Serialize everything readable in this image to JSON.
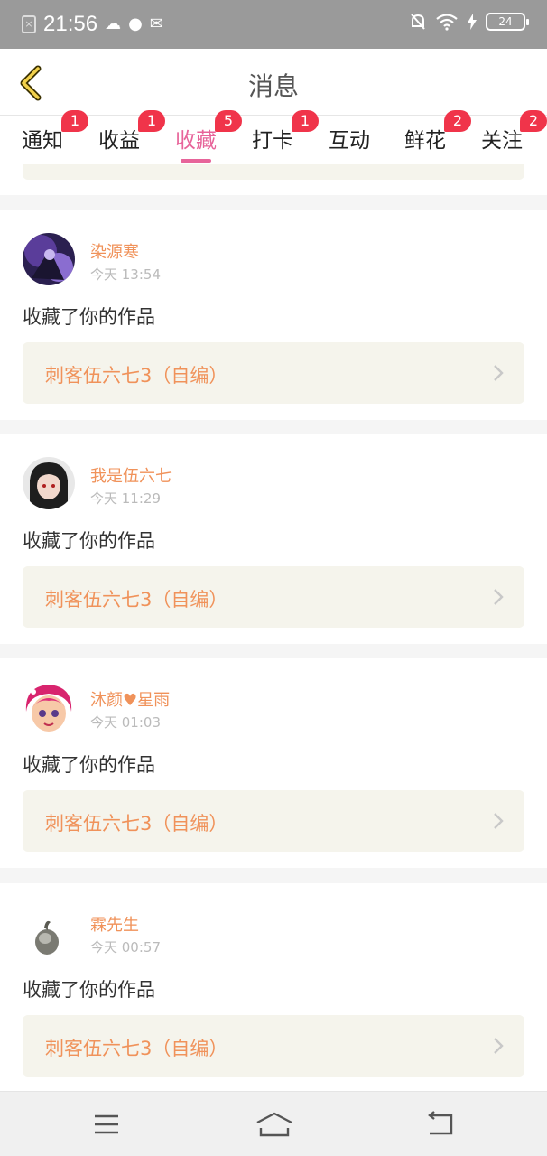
{
  "status_bar": {
    "time": "21:56",
    "battery": "24",
    "icons": [
      "sim-off-icon",
      "cloud-icon",
      "planet-icon",
      "mail-icon",
      "bell-off-icon",
      "wifi-icon",
      "charging-icon",
      "battery-icon"
    ]
  },
  "header": {
    "title": "消息",
    "back_icon": "chevron-left-icon"
  },
  "tabs": [
    {
      "label": "通知",
      "badge": "1",
      "active": false
    },
    {
      "label": "收益",
      "badge": "1",
      "active": false
    },
    {
      "label": "收藏",
      "badge": "5",
      "active": true
    },
    {
      "label": "打卡",
      "badge": "1",
      "active": false
    },
    {
      "label": "互动",
      "badge": "",
      "active": false
    },
    {
      "label": "鲜花",
      "badge": "2",
      "active": false
    },
    {
      "label": "关注",
      "badge": "2",
      "active": false
    }
  ],
  "messages": [
    {
      "user": "染源寒",
      "time": "今天 13:54",
      "action": "收藏了你的作品",
      "work": "刺客伍六七3（自编）"
    },
    {
      "user": "我是伍六七",
      "time": "今天 11:29",
      "action": "收藏了你的作品",
      "work": "刺客伍六七3（自编）"
    },
    {
      "user": "沐颜♥星雨",
      "time": "今天 01:03",
      "action": "收藏了你的作品",
      "work": "刺客伍六七3（自编）"
    },
    {
      "user": "霖先生",
      "time": "今天 00:57",
      "action": "收藏了你的作品",
      "work": "刺客伍六七3（自编）"
    }
  ],
  "nav_bar": {
    "icons": [
      "menu-icon",
      "home-icon",
      "back-icon"
    ]
  },
  "colors": {
    "accent": "#e7649a",
    "name": "#f0925a",
    "badge": "#f0344a",
    "work_bg": "#f5f4ec"
  }
}
